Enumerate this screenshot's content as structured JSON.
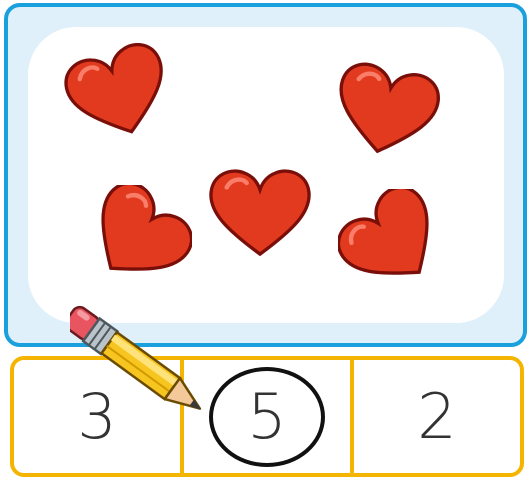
{
  "task": {
    "heart_count": 5,
    "items_icon": "heart-icon"
  },
  "answers": [
    {
      "label": "3",
      "selected": false
    },
    {
      "label": "5",
      "selected": true
    },
    {
      "label": "2",
      "selected": false
    }
  ],
  "colors": {
    "frame_border": "#1aa0dc",
    "frame_fill": "#dff0fb",
    "answer_border": "#f5b400",
    "heart_fill": "#e23a1f",
    "heart_outline": "#7a0f0a",
    "selection_ring": "#111111"
  },
  "cursor_icon": "pencil-icon"
}
